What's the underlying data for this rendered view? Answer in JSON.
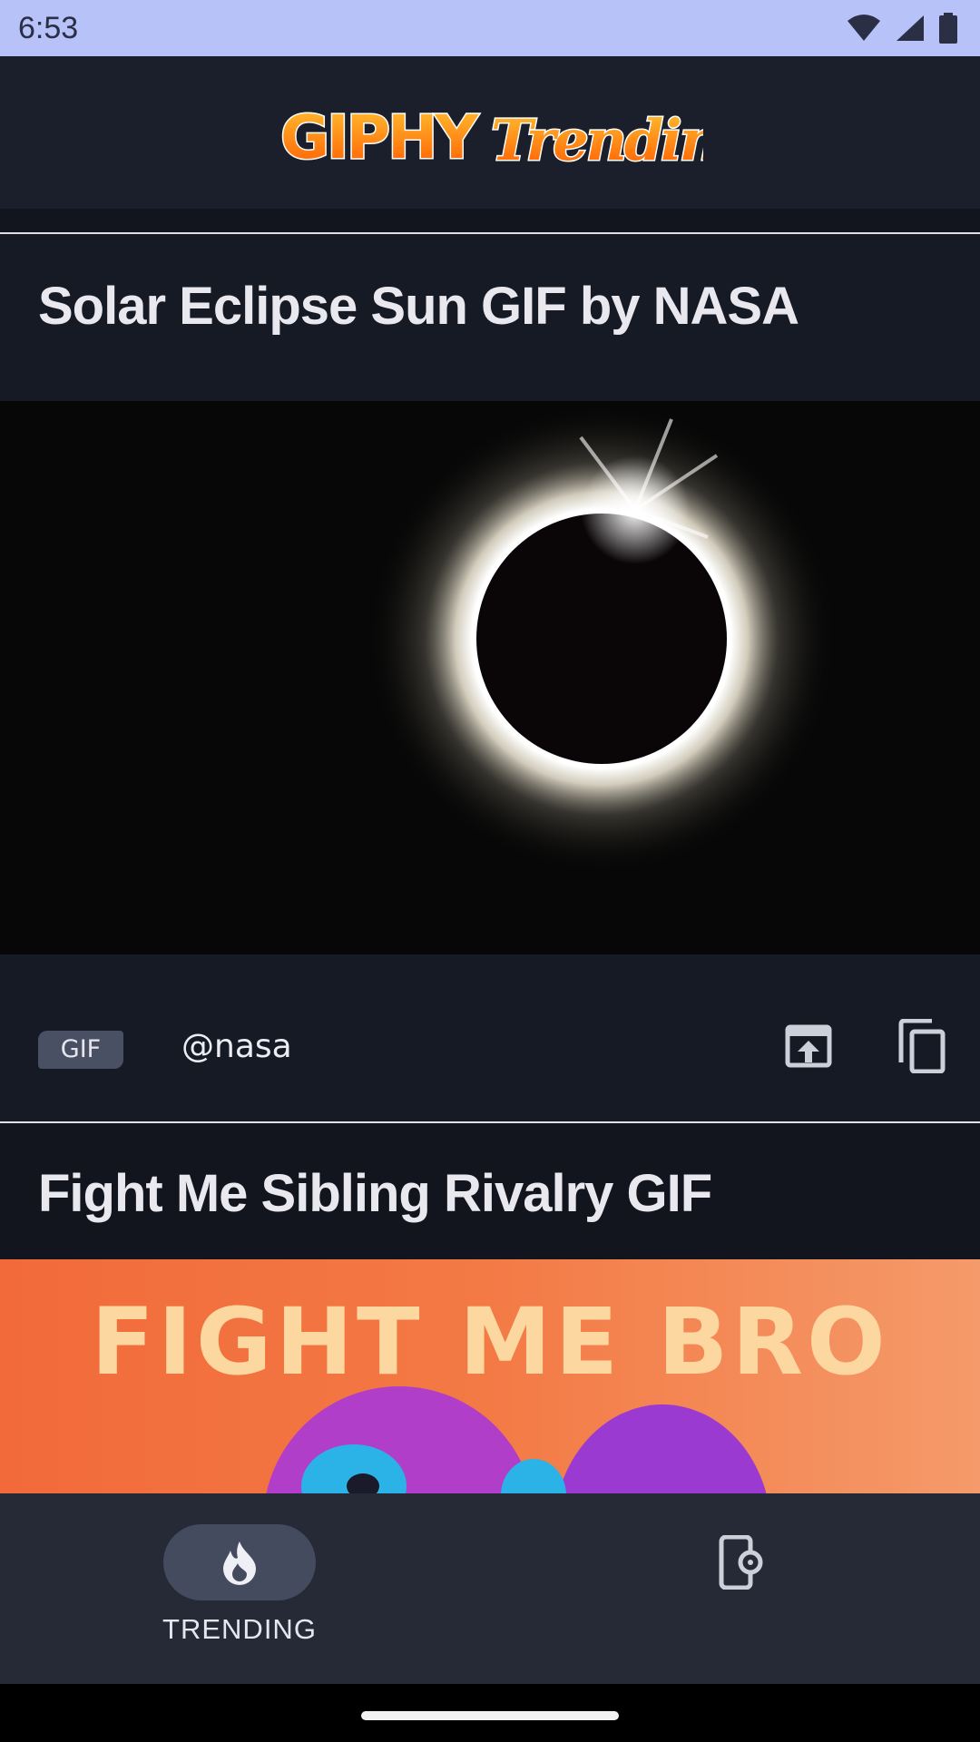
{
  "status_bar": {
    "time": "6:53",
    "icons": [
      "wifi-icon",
      "signal-icon",
      "battery-icon"
    ]
  },
  "header": {
    "logo_text_1": "GIPHY",
    "logo_text_2": "Trending"
  },
  "cards": [
    {
      "title": "Solar Eclipse Sun GIF by NASA",
      "badge": "GIF",
      "username": "@nasa",
      "image": "solar-eclipse-gif"
    },
    {
      "title": "Fight Me Sibling Rivalry GIF",
      "image": "fight-me-bro-gif",
      "image_text": "FIGHT ME BRO"
    }
  ],
  "bottom_nav": {
    "items": [
      {
        "label": "TRENDING",
        "icon": "flame-icon",
        "selected": true
      },
      {
        "label": "",
        "icon": "phone-settings-icon",
        "selected": false
      }
    ]
  },
  "colors": {
    "status_bar": "#b6c2f8",
    "app_bar": "#1b1f2b",
    "background": "#12151e",
    "logo_orange": "#ff7a00",
    "nav_pill": "#454b5e"
  }
}
